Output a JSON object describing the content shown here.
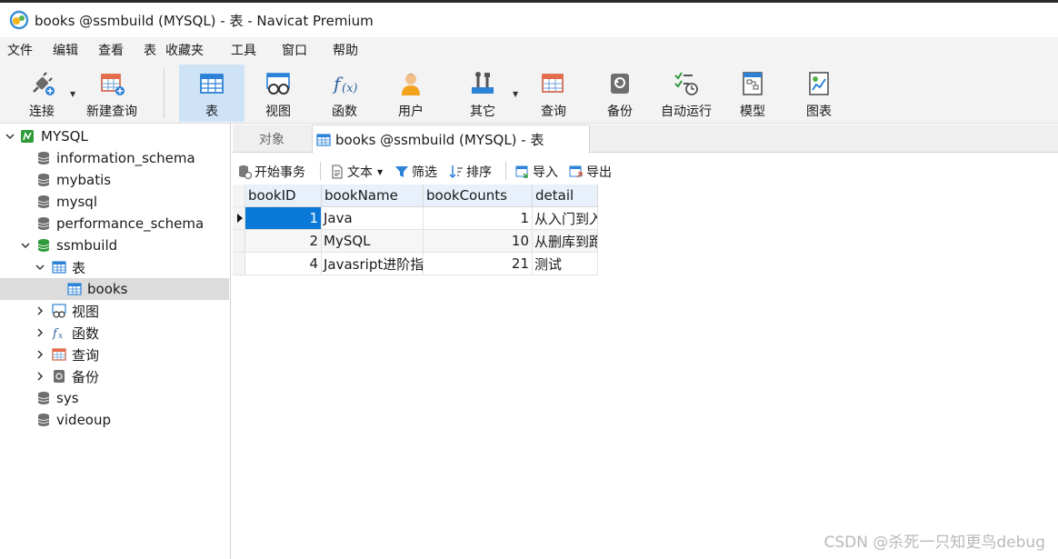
{
  "window": {
    "title": "books @ssmbuild (MYSQL) - 表 - Navicat Premium"
  },
  "menu": [
    "文件",
    "编辑",
    "查看",
    "表",
    "收藏夹",
    "工具",
    "窗口",
    "帮助"
  ],
  "toolbar": {
    "connect": "连接",
    "new_query": "新建查询",
    "table": "表",
    "view": "视图",
    "function": "函数",
    "user": "用户",
    "other": "其它",
    "query": "查询",
    "backup": "备份",
    "automation": "自动运行",
    "model": "模型",
    "chart": "图表"
  },
  "sidebar": {
    "connection": "MYSQL",
    "databases": [
      "information_schema",
      "mybatis",
      "mysql",
      "performance_schema",
      "ssmbuild",
      "sys",
      "videoup"
    ],
    "ssmbuild_children": {
      "tables": "表",
      "table_books": "books",
      "views": "视图",
      "functions": "函数",
      "queries": "查询",
      "backups": "备份"
    }
  },
  "tabs": {
    "objects": "对象",
    "active": "books @ssmbuild (MYSQL) - 表"
  },
  "subtoolbar": {
    "begin_transaction": "开始事务",
    "text": "文本",
    "filter": "筛选",
    "sort": "排序",
    "import": "导入",
    "export": "导出"
  },
  "grid": {
    "columns": [
      "bookID",
      "bookName",
      "bookCounts",
      "detail"
    ],
    "rows": [
      [
        "1",
        "Java",
        "1",
        "从入门到入"
      ],
      [
        "2",
        "MySQL",
        "10",
        "从删库到跑"
      ],
      [
        "4",
        "Javasript进阶指",
        "21",
        "测试"
      ]
    ]
  },
  "watermark": "CSDN @杀死一只知更鸟debug",
  "colors": {
    "selection": "#0a79d8",
    "toolbar_active": "#cfe3f7",
    "header": "#e8f1fb"
  }
}
